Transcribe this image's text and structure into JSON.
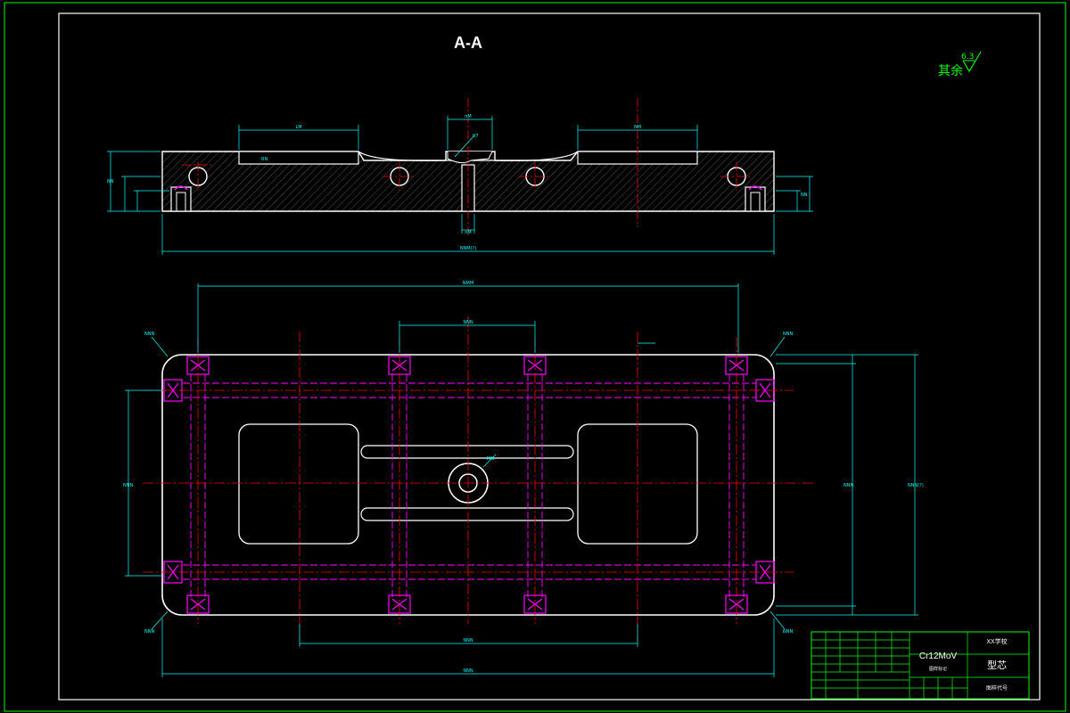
{
  "drawing": {
    "section_title": "A-A",
    "surface_finish": {
      "label": "其余",
      "value": "6.3"
    }
  },
  "section_view": {
    "dims": [
      "nM",
      "R7",
      "nM",
      "LM",
      "NM",
      "NNM(?)",
      "NN",
      "RN",
      "NN"
    ]
  },
  "plan_view": {
    "dims": [
      "NMM",
      "NNN",
      "NNN",
      "NNN",
      "NNN",
      "NNN",
      "NNN",
      "NNN",
      "MN",
      "NNN",
      "NNN",
      "NNN(?)"
    ]
  },
  "title_block": {
    "material": "Cr12MoV",
    "school": "XX学校",
    "part_name": "型芯",
    "row1": "图样标记",
    "row2": "图样代号"
  },
  "colors": {
    "border": "#00ff00",
    "outline": "#ffffff",
    "dimension": "#00ffff",
    "centerline": "#ff0000",
    "hidden": "#ff00ff"
  }
}
